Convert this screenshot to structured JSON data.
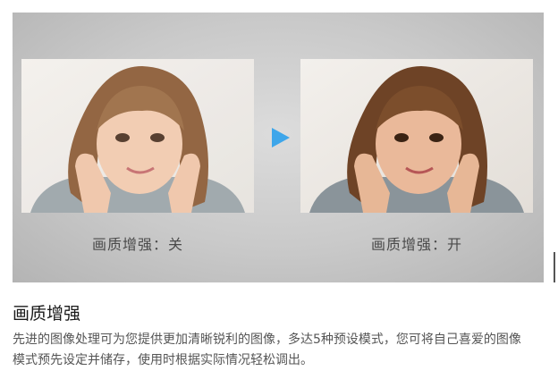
{
  "banner": {
    "before_caption": "画质增强：关",
    "after_caption": "画质增强：开",
    "arrow_icon": "play-arrow-icon",
    "arrow_color": "#3ea6ea"
  },
  "feature": {
    "title": "画质增强",
    "description": "先进的图像处理可为您提供更加清晰锐利的图像，多达5种预设模式，您可将自己喜爱的图像模式预先设定并储存，使用时根据实际情况轻松调出。"
  }
}
